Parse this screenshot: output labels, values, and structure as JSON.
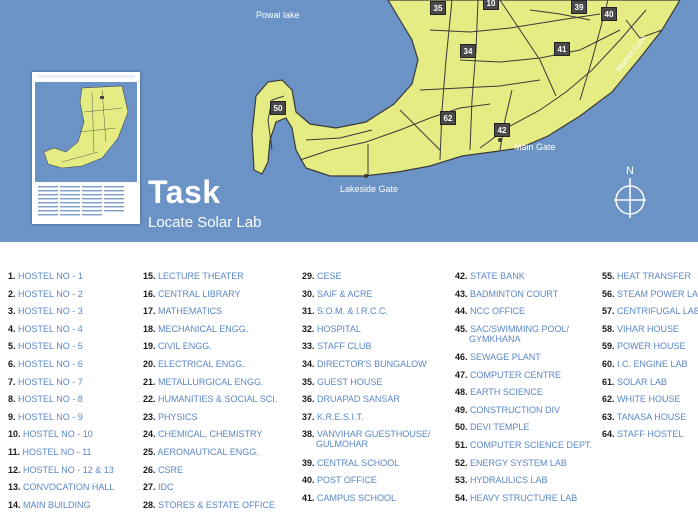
{
  "map": {
    "water_label": "Powai lake",
    "gates": {
      "main": "Main Gate",
      "market": "Market Gate",
      "lakeside": "Lakeside Gate"
    },
    "buildings": [
      "35",
      "10",
      "39",
      "40",
      "34",
      "41",
      "50",
      "62",
      "42"
    ],
    "compass_label": "N",
    "colors": {
      "water": "#6b93c6",
      "land": "#e5ec83",
      "marker": "#4a4a4a",
      "legend_label": "#5a87c5"
    }
  },
  "task": {
    "title": "Task",
    "subtitle": "Locate Solar Lab"
  },
  "legend": {
    "columns": [
      [
        {
          "num": "1.",
          "label": "HOSTEL NO - 1"
        },
        {
          "num": "2.",
          "label": "HOSTEL NO - 2"
        },
        {
          "num": "3.",
          "label": "HOSTEL NO - 3"
        },
        {
          "num": "4.",
          "label": "HOSTEL NO - 4"
        },
        {
          "num": "5.",
          "label": "HOSTEL NO - 5"
        },
        {
          "num": "6.",
          "label": "HOSTEL NO - 6"
        },
        {
          "num": "7.",
          "label": "HOSTEL NO - 7"
        },
        {
          "num": "8.",
          "label": "HOSTEL NO - 8"
        },
        {
          "num": "9.",
          "label": "HOSTEL NO - 9"
        },
        {
          "num": "10.",
          "label": "HOSTEL NO - 10"
        },
        {
          "num": "11.",
          "label": "HOSTEL NO - 11"
        },
        {
          "num": "12.",
          "label": "HOSTEL NO - 12 & 13"
        },
        {
          "num": "13.",
          "label": "CONVOCATION HALL"
        },
        {
          "num": "14.",
          "label": "MAIN BUILDING"
        }
      ],
      [
        {
          "num": "15.",
          "label": "LECTURE THEATER"
        },
        {
          "num": "16.",
          "label": "CENTRAL LIBRARY"
        },
        {
          "num": "17.",
          "label": "MATHEMATICS"
        },
        {
          "num": "18.",
          "label": "MECHANICAL ENGG."
        },
        {
          "num": "19.",
          "label": "CIVIL ENGG."
        },
        {
          "num": "20.",
          "label": "ELECTRICAL ENGG."
        },
        {
          "num": "21.",
          "label": "METALLURGICAL ENGG."
        },
        {
          "num": "22.",
          "label": "HUMANITIES & SOCIAL SCI."
        },
        {
          "num": "23.",
          "label": "PHYSICS"
        },
        {
          "num": "24.",
          "label": "CHEMICAL, CHEMISTRY"
        },
        {
          "num": "25.",
          "label": "AERONAUTICAL ENGG."
        },
        {
          "num": "26.",
          "label": "CSRE"
        },
        {
          "num": "27.",
          "label": "IDC"
        },
        {
          "num": "28.",
          "label": "STORES & ESTATE OFFICE"
        }
      ],
      [
        {
          "num": "29.",
          "label": "CESE"
        },
        {
          "num": "30.",
          "label": "SAIF & ACRE"
        },
        {
          "num": "31.",
          "label": "S.O.M. & I.R.C.C."
        },
        {
          "num": "32.",
          "label": "HOSPITAL"
        },
        {
          "num": "33.",
          "label": "STAFF CLUB"
        },
        {
          "num": "34.",
          "label": "DIRECTOR'S BUNGALOW"
        },
        {
          "num": "35.",
          "label": "GUEST HOUSE"
        },
        {
          "num": "36.",
          "label": "DRUAPAD SANSAR"
        },
        {
          "num": "37.",
          "label": "K.R.E.S.I.T."
        },
        {
          "num": "38.",
          "label": "VANVIHAR GUESTHOUSE/",
          "label2": "GULMOHAR"
        },
        {
          "num": "39.",
          "label": "CENTRAL SCHOOL"
        },
        {
          "num": "40.",
          "label": "POST OFFICE"
        },
        {
          "num": "41.",
          "label": "CAMPUS SCHOOL"
        }
      ],
      [
        {
          "num": "42.",
          "label": "STATE BANK"
        },
        {
          "num": "43.",
          "label": "BADMINTON COURT"
        },
        {
          "num": "44.",
          "label": "NCC OFFICE"
        },
        {
          "num": "45.",
          "label": "SAC/SWIMMING POOL/",
          "label2": "GYMKHANA"
        },
        {
          "num": "46.",
          "label": "SEWAGE PLANT"
        },
        {
          "num": "47.",
          "label": "COMPUTER CENTRE"
        },
        {
          "num": "48.",
          "label": "EARTH SCIENCE"
        },
        {
          "num": "49.",
          "label": "CONSTRUCTION DIV"
        },
        {
          "num": "50.",
          "label": "DEVI TEMPLE"
        },
        {
          "num": "51.",
          "label": "COMPUTER SCIENCE DEPT."
        },
        {
          "num": "52.",
          "label": "ENERGY SYSTEM LAB"
        },
        {
          "num": "53.",
          "label": "HYDRAULICS LAB"
        },
        {
          "num": "54.",
          "label": "HEAVY STRUCTURE LAB"
        }
      ],
      [
        {
          "num": "55.",
          "label": "HEAT TRANSFER"
        },
        {
          "num": "56.",
          "label": "STEAM POWER LAB"
        },
        {
          "num": "57.",
          "label": "CENTRIFUGAL LAB"
        },
        {
          "num": "58.",
          "label": "VIHAR HOUSE"
        },
        {
          "num": "59.",
          "label": "POWER HOUSE"
        },
        {
          "num": "60.",
          "label": "I.C. ENGINE LAB"
        },
        {
          "num": "61.",
          "label": "SOLAR LAB"
        },
        {
          "num": "62.",
          "label": "WHITE HOUSE"
        },
        {
          "num": "63.",
          "label": "TANASA HOUSE"
        },
        {
          "num": "64.",
          "label": "STAFF HOSTEL"
        }
      ]
    ]
  }
}
